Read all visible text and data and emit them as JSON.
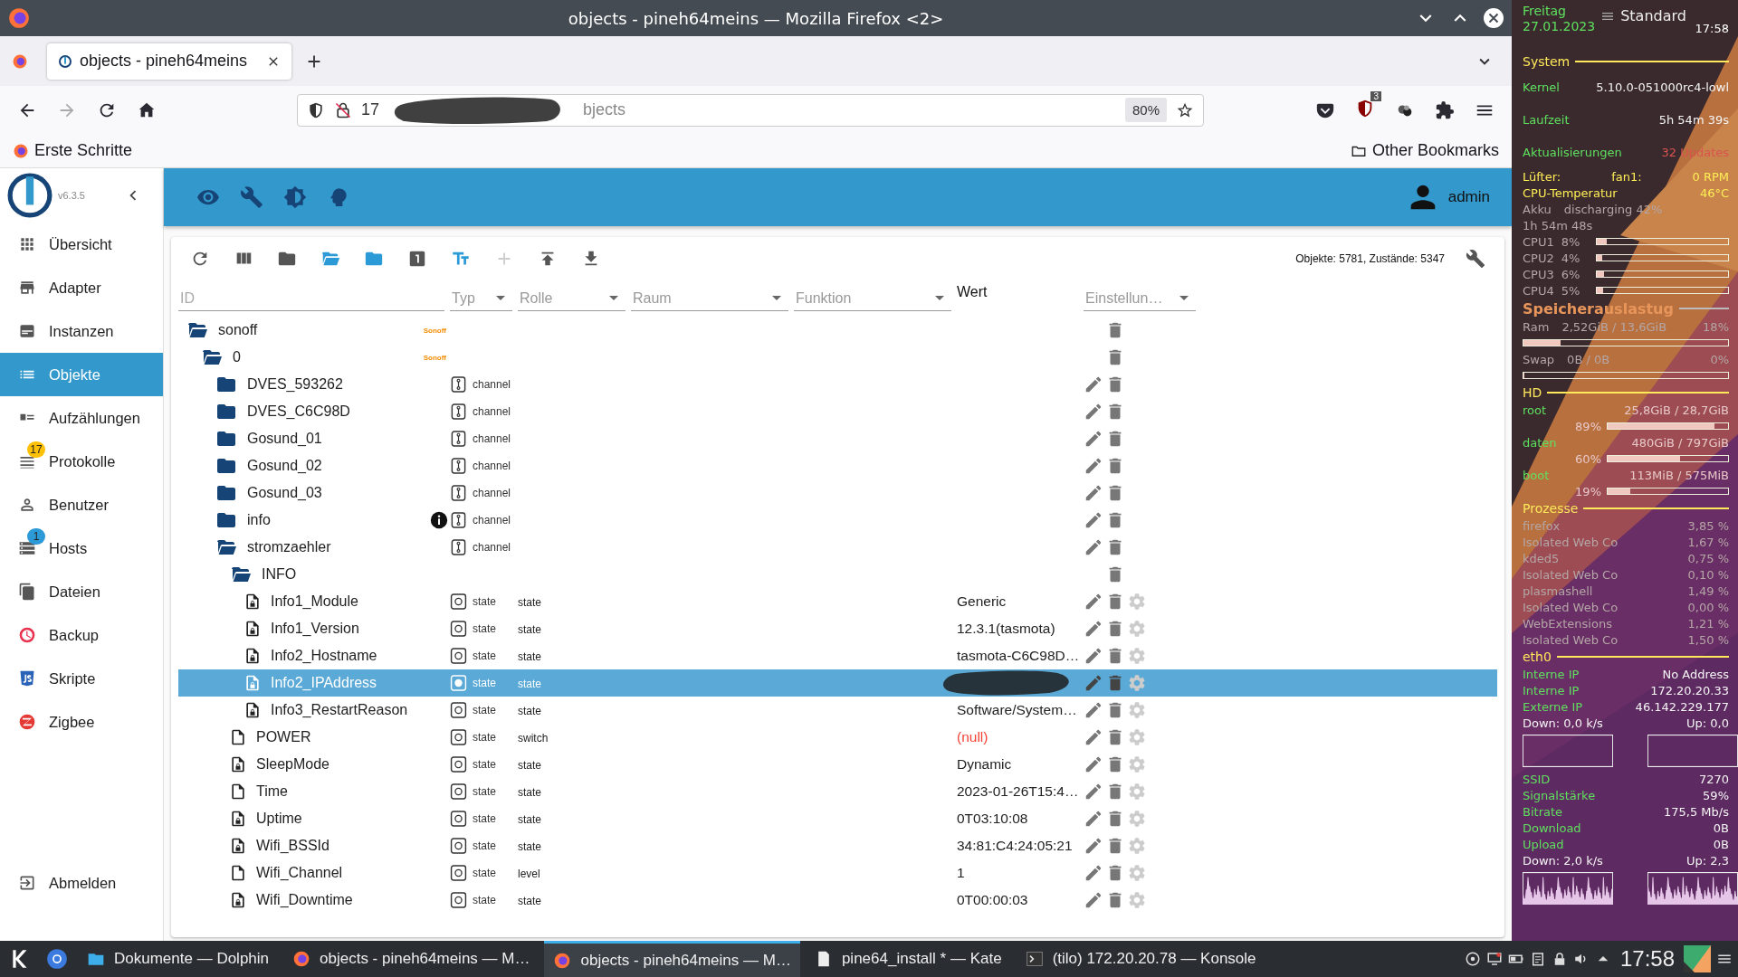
{
  "window": {
    "title": "objects - pineh64meins — Mozilla Firefox <2>"
  },
  "tabs": [
    {
      "label": "objects - pineh64meins",
      "selected": true
    }
  ],
  "address_bar": {
    "visible_start": "17",
    "visible_end": "bjects",
    "redacted": true,
    "zoom": "80%"
  },
  "extension_badge": "3",
  "bookmarks": {
    "left": "Erste Schritte",
    "right": "Other Bookmarks"
  },
  "app": {
    "version": "v6.3.5",
    "user": "admin",
    "nav": [
      {
        "label": "Übersicht",
        "selected": false
      },
      {
        "label": "Adapter",
        "selected": false
      },
      {
        "label": "Instanzen",
        "selected": false
      },
      {
        "label": "Objekte",
        "selected": true
      },
      {
        "label": "Aufzählungen",
        "selected": false
      },
      {
        "label": "Protokolle",
        "selected": false,
        "badge": {
          "text": "17",
          "color": "#ffc107"
        }
      },
      {
        "label": "Benutzer",
        "selected": false
      },
      {
        "label": "Hosts",
        "selected": false,
        "badge": {
          "text": "1",
          "color": "#2d9ad8"
        }
      },
      {
        "label": "Dateien",
        "selected": false
      },
      {
        "label": "Backup",
        "selected": false
      },
      {
        "label": "Skripte",
        "selected": false
      },
      {
        "label": "Zigbee",
        "selected": false
      }
    ],
    "logout": "Abmelden",
    "counts": "Objekte: 5781, Zustände: 5347",
    "filters": {
      "id": {
        "placeholder": "ID"
      },
      "type": {
        "placeholder": "Typ"
      },
      "role": {
        "placeholder": "Rolle"
      },
      "room": {
        "placeholder": "Raum"
      },
      "function": {
        "placeholder": "Funktion"
      },
      "value": "Wert",
      "settings": {
        "placeholder": "Einstellun…"
      }
    },
    "tree": [
      {
        "kind": "adapter",
        "name": "sonoff",
        "logo": "Sonoff",
        "expanded": true,
        "selected": false,
        "children": [
          {
            "kind": "adapter",
            "name": "0",
            "logo": "Sonoff",
            "expanded": true,
            "selected": false,
            "children": [
              {
                "kind": "channel",
                "name": "DVES_593262",
                "type": "channel",
                "expanded": false,
                "info": false,
                "selected": false
              },
              {
                "kind": "channel",
                "name": "DVES_C6C98D",
                "type": "channel",
                "expanded": false,
                "info": false,
                "selected": false
              },
              {
                "kind": "channel",
                "name": "Gosund_01",
                "type": "channel",
                "expanded": false,
                "info": false,
                "selected": false
              },
              {
                "kind": "channel",
                "name": "Gosund_02",
                "type": "channel",
                "expanded": false,
                "info": false,
                "selected": false
              },
              {
                "kind": "channel",
                "name": "Gosund_03",
                "type": "channel",
                "expanded": false,
                "info": false,
                "selected": false
              },
              {
                "kind": "channel",
                "name": "info",
                "type": "channel",
                "expanded": false,
                "info": true,
                "selected": false
              },
              {
                "kind": "channel",
                "name": "stromzaehler",
                "type": "channel",
                "expanded": true,
                "info": false,
                "selected": false,
                "children": [
                  {
                    "kind": "folder",
                    "name": "INFO",
                    "expanded": true,
                    "selected": false,
                    "children": [
                      {
                        "kind": "state",
                        "name": "Info1_Module",
                        "type": "state",
                        "role": "state",
                        "value": "Generic",
                        "read_only": true,
                        "null": false,
                        "redacted": false,
                        "selected": false
                      },
                      {
                        "kind": "state",
                        "name": "Info1_Version",
                        "type": "state",
                        "role": "state",
                        "value": "12.3.1(tasmota)",
                        "read_only": true,
                        "null": false,
                        "redacted": false,
                        "selected": false
                      },
                      {
                        "kind": "state",
                        "name": "Info2_Hostname",
                        "type": "state",
                        "role": "state",
                        "value": "tasmota-C6C98D…",
                        "read_only": true,
                        "null": false,
                        "redacted": false,
                        "selected": false
                      },
                      {
                        "kind": "state",
                        "name": "Info2_IPAddress",
                        "type": "state",
                        "role": "state",
                        "read_only": true,
                        "redacted": true,
                        "selected": true
                      },
                      {
                        "kind": "state",
                        "name": "Info3_RestartReason",
                        "type": "state",
                        "role": "state",
                        "value": "Software/System…",
                        "read_only": true,
                        "null": false,
                        "redacted": false,
                        "selected": false
                      }
                    ]
                  },
                  {
                    "kind": "state",
                    "name": "POWER",
                    "type": "state",
                    "role": "switch",
                    "value": "(null)",
                    "read_only": false,
                    "null": true,
                    "redacted": false,
                    "selected": false
                  },
                  {
                    "kind": "state",
                    "name": "SleepMode",
                    "type": "state",
                    "role": "state",
                    "value": "Dynamic",
                    "read_only": true,
                    "null": false,
                    "redacted": false,
                    "selected": false
                  },
                  {
                    "kind": "state",
                    "name": "Time",
                    "type": "state",
                    "role": "state",
                    "value": "2023-01-26T15:4…",
                    "read_only": false,
                    "null": false,
                    "redacted": false,
                    "selected": false
                  },
                  {
                    "kind": "state",
                    "name": "Uptime",
                    "type": "state",
                    "role": "state",
                    "value": "0T03:10:08",
                    "read_only": true,
                    "null": false,
                    "redacted": false,
                    "selected": false
                  },
                  {
                    "kind": "state",
                    "name": "Wifi_BSSId",
                    "type": "state",
                    "role": "state",
                    "value": "34:81:C4:24:05:21",
                    "read_only": true,
                    "null": false,
                    "redacted": false,
                    "selected": false
                  },
                  {
                    "kind": "state",
                    "name": "Wifi_Channel",
                    "type": "state",
                    "role": "level",
                    "value": "1",
                    "read_only": false,
                    "null": false,
                    "redacted": false,
                    "selected": false
                  },
                  {
                    "kind": "state",
                    "name": "Wifi_Downtime",
                    "type": "state",
                    "role": "state",
                    "value": "0T00:00:03",
                    "read_only": true,
                    "null": false,
                    "redacted": false,
                    "selected": false
                  }
                ]
              }
            ]
          }
        ]
      }
    ]
  },
  "desktop": {
    "day": "Freitag",
    "date": "27.01.2023",
    "activity": "Standard",
    "time": "17:58",
    "rows": [
      {
        "kind": "section",
        "label": "System"
      },
      {
        "kind": "metric",
        "label": "Kernel",
        "value": "5.10.0-051000rc4-lowl"
      },
      {
        "kind": "metric",
        "label": "Laufzeit",
        "value": "5h 54m 39s"
      },
      {
        "kind": "alert",
        "label": "Aktualisierungen",
        "value": "32 Updates"
      },
      {
        "kind": "sensor",
        "label": "Lüfter:",
        "middle": "fan1:",
        "value": "0 RPM"
      },
      {
        "kind": "sensor",
        "label": "CPU-Temperatur",
        "value": "46°C"
      },
      {
        "kind": "stat",
        "label": "Akku",
        "middle": "discharging 42%"
      },
      {
        "kind": "stat",
        "label": "1h 54m 48s"
      },
      {
        "kind": "cpu",
        "label": "CPU1",
        "value": "8%",
        "level": 0.08
      },
      {
        "kind": "cpu",
        "label": "CPU2",
        "value": "4%",
        "level": 0.04
      },
      {
        "kind": "cpu",
        "label": "CPU3",
        "value": "6%",
        "level": 0.06
      },
      {
        "kind": "cpu",
        "label": "CPU4",
        "value": "5%",
        "level": 0.05
      },
      {
        "kind": "heading",
        "label": "Speicherauslastug"
      },
      {
        "kind": "stat",
        "label": "Ram",
        "middle": "2,52GiB / 13,6GiB",
        "value": "18%"
      },
      {
        "kind": "bar",
        "level": 0.18
      },
      {
        "kind": "stat",
        "label": "Swap",
        "middle": "0B   / 0B",
        "value": "0%"
      },
      {
        "kind": "bar",
        "level": 0
      },
      {
        "kind": "section",
        "label": "HD"
      },
      {
        "kind": "disk",
        "label": "root",
        "value": "25,8GiB / 28,7GiB"
      },
      {
        "kind": "usage",
        "value": "89%",
        "level": 0.89
      },
      {
        "kind": "disk",
        "label": "daten",
        "value": "480GiB / 797GiB"
      },
      {
        "kind": "usage",
        "value": "60%",
        "level": 0.6
      },
      {
        "kind": "disk",
        "label": "boot",
        "value": "113MiB / 575MiB"
      },
      {
        "kind": "usage",
        "value": "19%",
        "level": 0.19
      },
      {
        "kind": "section",
        "label": "Prozesse"
      },
      {
        "kind": "stat",
        "label": "firefox",
        "value": "3,85 %"
      },
      {
        "kind": "stat",
        "label": "Isolated Web Co",
        "value": "1,67 %"
      },
      {
        "kind": "stat",
        "label": "kded5",
        "value": "0,75 %"
      },
      {
        "kind": "stat",
        "label": "Isolated Web Co",
        "value": "0,10 %"
      },
      {
        "kind": "stat",
        "label": "plasmashell",
        "value": "1,49 %"
      },
      {
        "kind": "stat",
        "label": "Isolated Web Co",
        "value": "0,00 %"
      },
      {
        "kind": "stat",
        "label": "WebExtensions",
        "value": "1,21 %"
      },
      {
        "kind": "stat",
        "label": "Isolated Web Co",
        "value": "1,50 %"
      },
      {
        "kind": "section",
        "label": "eth0"
      },
      {
        "kind": "metric",
        "label": "Interne IP",
        "value": "No Address"
      },
      {
        "kind": "metric",
        "label": "Interne IP",
        "value": "172.20.20.33"
      },
      {
        "kind": "metric",
        "label": "Externe IP",
        "value": "46.142.229.177"
      },
      {
        "kind": "rate",
        "label": "Down: 0,0 k/s",
        "value": "Up: 0,0"
      },
      {
        "kind": "graphs",
        "busy": false
      },
      {
        "kind": "metric",
        "label": "SSID",
        "value": "7270"
      },
      {
        "kind": "metric",
        "label": "Signalstärke",
        "value": "59%"
      },
      {
        "kind": "metric",
        "label": "Bitrate",
        "value": "175,5 Mb/s"
      },
      {
        "kind": "metric",
        "label": "Download",
        "value": "0B"
      },
      {
        "kind": "metric",
        "label": "Upload",
        "value": "0B"
      },
      {
        "kind": "rate",
        "label": "Down: 2,0 k/s",
        "value": "Up: 2,3"
      },
      {
        "kind": "graphs",
        "busy": true
      }
    ]
  },
  "taskbar": {
    "tasks": [
      {
        "label": "Dokumente — Dolphin",
        "selected": false
      },
      {
        "label": "objects - pineh64meins — M…",
        "selected": false
      },
      {
        "label": "objects - pineh64meins — M…",
        "selected": true
      },
      {
        "label": "pine64_install * — Kate",
        "selected": false
      },
      {
        "label": "(tilo) 172.20.20.78 — Konsole",
        "selected": false
      }
    ],
    "clock": "17:58"
  }
}
